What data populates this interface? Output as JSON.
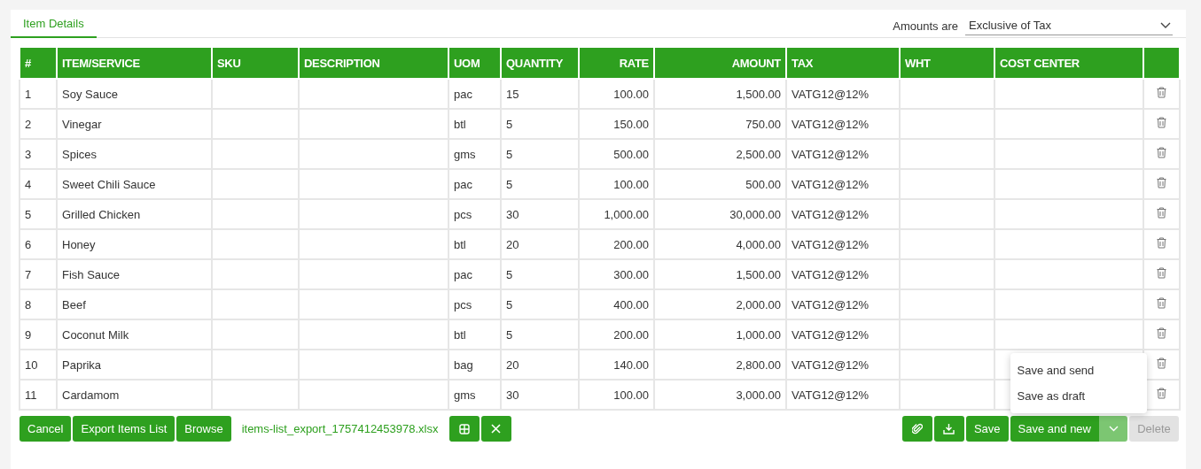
{
  "tabs": [
    {
      "label": "Item Details",
      "selected": true
    }
  ],
  "amounts": {
    "label": "Amounts are",
    "value": "Exclusive of Tax"
  },
  "table": {
    "columns": [
      {
        "label": "#",
        "numeric": false
      },
      {
        "label": "ITEM/SERVICE",
        "numeric": false
      },
      {
        "label": "SKU",
        "numeric": false
      },
      {
        "label": "DESCRIPTION",
        "numeric": false
      },
      {
        "label": "UOM",
        "numeric": false
      },
      {
        "label": "QUANTITY",
        "numeric": false
      },
      {
        "label": "RATE",
        "numeric": true
      },
      {
        "label": "AMOUNT",
        "numeric": true
      },
      {
        "label": "TAX",
        "numeric": false
      },
      {
        "label": "WHT",
        "numeric": false
      },
      {
        "label": "COST CENTER",
        "numeric": false
      }
    ],
    "rows": [
      [
        "1",
        "Soy Sauce",
        "",
        "",
        "pac",
        "15",
        "100.00",
        "1,500.00",
        "VATG12@12%",
        "",
        ""
      ],
      [
        "2",
        "Vinegar",
        "",
        "",
        "btl",
        "5",
        "150.00",
        "750.00",
        "VATG12@12%",
        "",
        ""
      ],
      [
        "3",
        "Spices",
        "",
        "",
        "gms",
        "5",
        "500.00",
        "2,500.00",
        "VATG12@12%",
        "",
        ""
      ],
      [
        "4",
        "Sweet Chili Sauce",
        "",
        "",
        "pac",
        "5",
        "100.00",
        "500.00",
        "VATG12@12%",
        "",
        ""
      ],
      [
        "5",
        "Grilled Chicken",
        "",
        "",
        "pcs",
        "30",
        "1,000.00",
        "30,000.00",
        "VATG12@12%",
        "",
        ""
      ],
      [
        "6",
        "Honey",
        "",
        "",
        "btl",
        "20",
        "200.00",
        "4,000.00",
        "VATG12@12%",
        "",
        ""
      ],
      [
        "7",
        "Fish Sauce",
        "",
        "",
        "pac",
        "5",
        "300.00",
        "1,500.00",
        "VATG12@12%",
        "",
        ""
      ],
      [
        "8",
        "Beef",
        "",
        "",
        "pcs",
        "5",
        "400.00",
        "2,000.00",
        "VATG12@12%",
        "",
        ""
      ],
      [
        "9",
        "Coconut Milk",
        "",
        "",
        "btl",
        "5",
        "200.00",
        "1,000.00",
        "VATG12@12%",
        "",
        ""
      ],
      [
        "10",
        "Paprika",
        "",
        "",
        "bag",
        "20",
        "140.00",
        "2,800.00",
        "VATG12@12%",
        "",
        ""
      ],
      [
        "11",
        "Cardamom",
        "",
        "",
        "gms",
        "30",
        "100.00",
        "3,000.00",
        "VATG12@12%",
        "",
        ""
      ]
    ]
  },
  "footer_left": [
    {
      "kind": "text",
      "label": "Cancel"
    },
    {
      "kind": "text",
      "label": "Export Items List"
    },
    {
      "kind": "text",
      "label": "Browse"
    },
    {
      "kind": "file",
      "label": "items-list_export_1757412453978.xlsx"
    },
    {
      "kind": "grid"
    },
    {
      "kind": "close"
    }
  ],
  "footer_right": [
    {
      "kind": "attach"
    },
    {
      "kind": "download"
    },
    {
      "kind": "text",
      "label": "Save",
      "disabled": false
    },
    {
      "kind": "split",
      "label": "Save and new",
      "expanded": true
    },
    {
      "kind": "text",
      "label": "Delete",
      "disabled": true
    }
  ],
  "menu": [
    "Save and send",
    "Save as draft"
  ]
}
